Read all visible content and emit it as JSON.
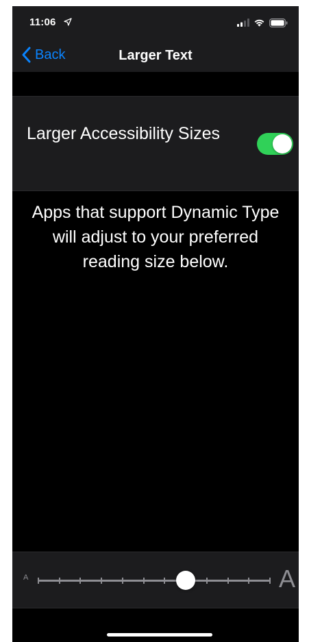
{
  "status_bar": {
    "time": "11:06",
    "icons": [
      "location-arrow-icon",
      "signal-icon",
      "wifi-icon",
      "battery-icon"
    ]
  },
  "nav": {
    "back_label": "Back",
    "title": "Larger Text",
    "back_icon": "chevron-left-icon"
  },
  "toggle": {
    "label": "Larger Accessibility Sizes",
    "on": true
  },
  "description": "Apps that support Dynamic Type will adjust to your preferred reading size below.",
  "slider": {
    "small_label": "A",
    "large_label": "A",
    "steps": 12,
    "value_step": 7
  },
  "colors": {
    "background": "#000000",
    "panel": "#1c1c1e",
    "accent": "#0a84ff",
    "toggle_on": "#30d158",
    "secondary_text": "#8e8e93"
  }
}
